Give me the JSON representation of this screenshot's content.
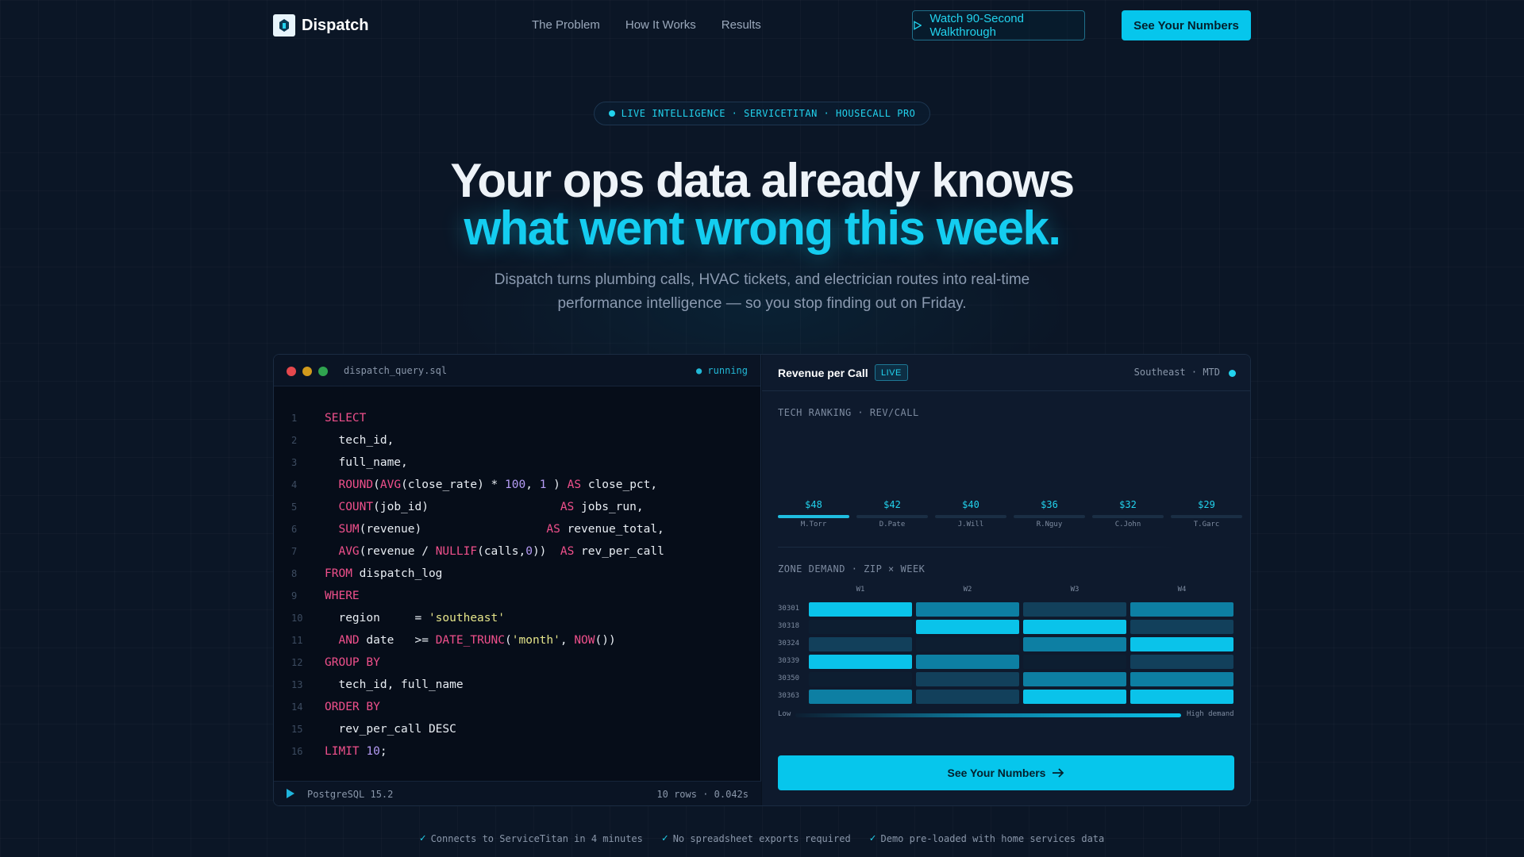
{
  "nav": {
    "brand": "Dispatch",
    "links": [
      "The Problem",
      "How It Works",
      "Results"
    ],
    "walkthrough_label": "Watch 90-Second Walkthrough",
    "cta_label": "See Your Numbers"
  },
  "hero": {
    "badge": "LIVE INTELLIGENCE · SERVICETITAN · HOUSECALL PRO",
    "headline_1": "Your ops data already knows",
    "headline_2": "what went wrong this week.",
    "subhead": "Dispatch turns plumbing calls, HVAC tickets, and electrician routes into real-time performance intelligence — so you stop finding out on Friday."
  },
  "editor": {
    "filename": "dispatch_query.sql",
    "status": "● running",
    "footer_engine": "PostgreSQL 15.2",
    "footer_stats": "10 rows · 0.042s",
    "lines": [
      [
        [
          "kw",
          "SELECT"
        ]
      ],
      [
        [
          "",
          "  tech_id,"
        ]
      ],
      [
        [
          "",
          "  full_name,"
        ]
      ],
      [
        [
          "",
          "  "
        ],
        [
          "kw",
          "ROUND"
        ],
        [
          "",
          "("
        ],
        [
          "kw",
          "AVG"
        ],
        [
          "",
          "(close_rate) * "
        ],
        [
          "num",
          "100"
        ],
        [
          "",
          ", "
        ],
        [
          "num",
          "1"
        ],
        [
          "",
          " ) "
        ],
        [
          "kw",
          "AS"
        ],
        [
          "",
          " close_pct,"
        ]
      ],
      [
        [
          "",
          "  "
        ],
        [
          "kw",
          "COUNT"
        ],
        [
          "",
          "(job_id)                   "
        ],
        [
          "kw",
          "AS"
        ],
        [
          "",
          " jobs_run,"
        ]
      ],
      [
        [
          "",
          "  "
        ],
        [
          "kw",
          "SUM"
        ],
        [
          "",
          "(revenue)                  "
        ],
        [
          "kw",
          "AS"
        ],
        [
          "",
          " revenue_total,"
        ]
      ],
      [
        [
          "",
          "  "
        ],
        [
          "kw",
          "AVG"
        ],
        [
          "",
          "(revenue / "
        ],
        [
          "kw",
          "NULLIF"
        ],
        [
          "",
          "(calls,"
        ],
        [
          "num",
          "0"
        ],
        [
          "",
          "))  "
        ],
        [
          "kw",
          "AS"
        ],
        [
          "",
          " rev_per_call"
        ]
      ],
      [
        [
          "kw",
          "FROM"
        ],
        [
          "",
          " dispatch_log"
        ]
      ],
      [
        [
          "kw",
          "WHERE"
        ]
      ],
      [
        [
          "",
          "  region     = "
        ],
        [
          "str",
          "'southeast'"
        ]
      ],
      [
        [
          "",
          "  "
        ],
        [
          "kw",
          "AND"
        ],
        [
          "",
          " date   >= "
        ],
        [
          "kw",
          "DATE_TRUNC"
        ],
        [
          "",
          "("
        ],
        [
          "str",
          "'month'"
        ],
        [
          "",
          ", "
        ],
        [
          "kw",
          "NOW"
        ],
        [
          "",
          "())"
        ]
      ],
      [
        [
          "kw",
          "GROUP BY"
        ]
      ],
      [
        [
          "",
          "  tech_id, full_name"
        ]
      ],
      [
        [
          "kw",
          "ORDER BY"
        ]
      ],
      [
        [
          "",
          "  rev_per_call DESC"
        ]
      ],
      [
        [
          "kw",
          "LIMIT"
        ],
        [
          "",
          " "
        ],
        [
          "num",
          "10"
        ],
        [
          "",
          ";"
        ]
      ]
    ]
  },
  "dashboard": {
    "title": "Revenue per Call",
    "badge": "LIVE",
    "region": "Southeast · MTD",
    "ranking_title": "TECH RANKING · REV/CALL",
    "ranking": [
      {
        "name": "M.Torr",
        "value": "$48"
      },
      {
        "name": "D.Pate",
        "value": "$42"
      },
      {
        "name": "J.Will",
        "value": "$40"
      },
      {
        "name": "R.Nguy",
        "value": "$36"
      },
      {
        "name": "C.John",
        "value": "$32"
      },
      {
        "name": "T.Garc",
        "value": "$29"
      }
    ],
    "heatmap_title": "ZONE DEMAND · ZIP × WEEK",
    "weeks": [
      "W1",
      "W2",
      "W3",
      "W4"
    ],
    "zips": [
      "30301",
      "30318",
      "30324",
      "30339",
      "30350",
      "30363"
    ],
    "demand_levels": [
      [
        3,
        2,
        1,
        2
      ],
      [
        0,
        3,
        3,
        1
      ],
      [
        1,
        0,
        2,
        3
      ],
      [
        3,
        2,
        0,
        1
      ],
      [
        0,
        1,
        2,
        2
      ],
      [
        2,
        1,
        3,
        3
      ]
    ],
    "legend_low": "Low",
    "legend_high": "High demand",
    "cta_label": "See Your Numbers"
  },
  "trust": [
    "Connects to ServiceTitan in 4 minutes",
    "No spreadsheet exports required",
    "Demo pre-loaded with home services data"
  ],
  "colors": {
    "accent": "#06c6ec",
    "background": "#0b1626",
    "keyword": "#f0508c",
    "number": "#b59cf5",
    "string": "#e5e58a"
  }
}
